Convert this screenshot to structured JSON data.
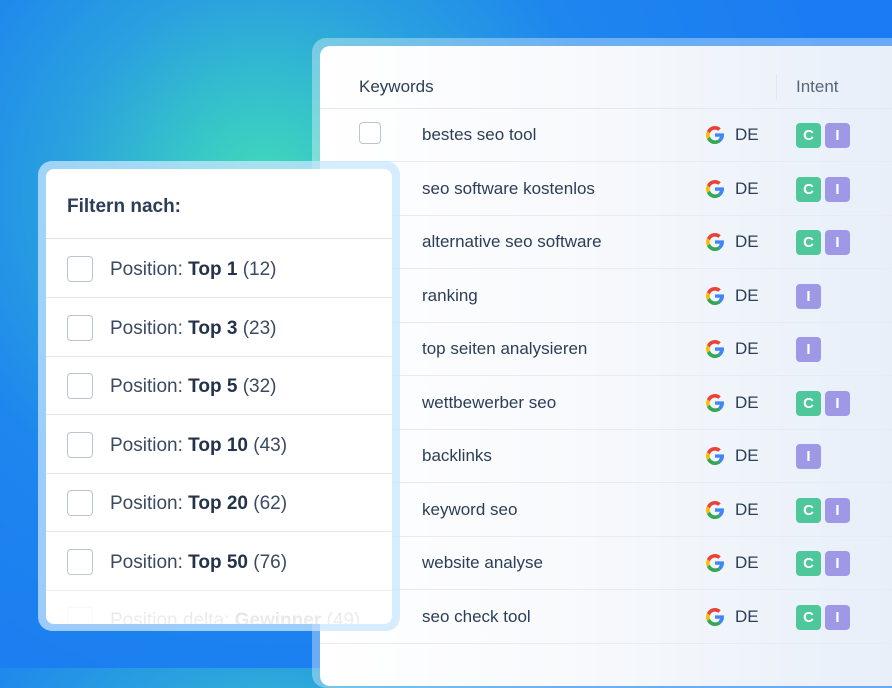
{
  "table": {
    "header": {
      "keywords": "Keywords",
      "intent": "Intent"
    },
    "rows": [
      {
        "keyword": "bestes seo tool",
        "country": "DE",
        "intents": [
          "C",
          "I"
        ]
      },
      {
        "keyword": "seo software kostenlos",
        "country": "DE",
        "intents": [
          "C",
          "I"
        ]
      },
      {
        "keyword": "alternative seo software",
        "country": "DE",
        "intents": [
          "C",
          "I"
        ]
      },
      {
        "keyword": "ranking",
        "country": "DE",
        "intents": [
          "I"
        ]
      },
      {
        "keyword": "top seiten analysieren",
        "country": "DE",
        "intents": [
          "I"
        ]
      },
      {
        "keyword": "wettbewerber seo",
        "country": "DE",
        "intents": [
          "C",
          "I"
        ]
      },
      {
        "keyword": "backlinks",
        "country": "DE",
        "intents": [
          "I"
        ]
      },
      {
        "keyword": "keyword seo",
        "country": "DE",
        "intents": [
          "C",
          "I"
        ]
      },
      {
        "keyword": "website analyse",
        "country": "DE",
        "intents": [
          "C",
          "I"
        ]
      },
      {
        "keyword": "seo check tool",
        "country": "DE",
        "intents": [
          "C",
          "I"
        ]
      }
    ]
  },
  "filter": {
    "title": "Filtern nach:",
    "options": [
      {
        "prefix": "Position: ",
        "value": "Top 1",
        "count": " (12)"
      },
      {
        "prefix": "Position: ",
        "value": "Top 3",
        "count": " (23)"
      },
      {
        "prefix": "Position: ",
        "value": "Top 5",
        "count": " (32)"
      },
      {
        "prefix": "Position: ",
        "value": "Top 10",
        "count": " (43)"
      },
      {
        "prefix": "Position: ",
        "value": "Top 20",
        "count": " (62)"
      },
      {
        "prefix": "Position: ",
        "value": "Top 50",
        "count": " (76)"
      },
      {
        "prefix": "Position delta: ",
        "value": "Gewinner",
        "count": " (49)"
      }
    ]
  },
  "colors": {
    "commercial_badge": "#4ec79a",
    "informational_badge": "#9e98e6",
    "google_blue": "#4285F4",
    "google_red": "#EA4335",
    "google_yellow": "#FBBC05",
    "google_green": "#34A853"
  },
  "icons": {
    "engine": "google-icon"
  }
}
